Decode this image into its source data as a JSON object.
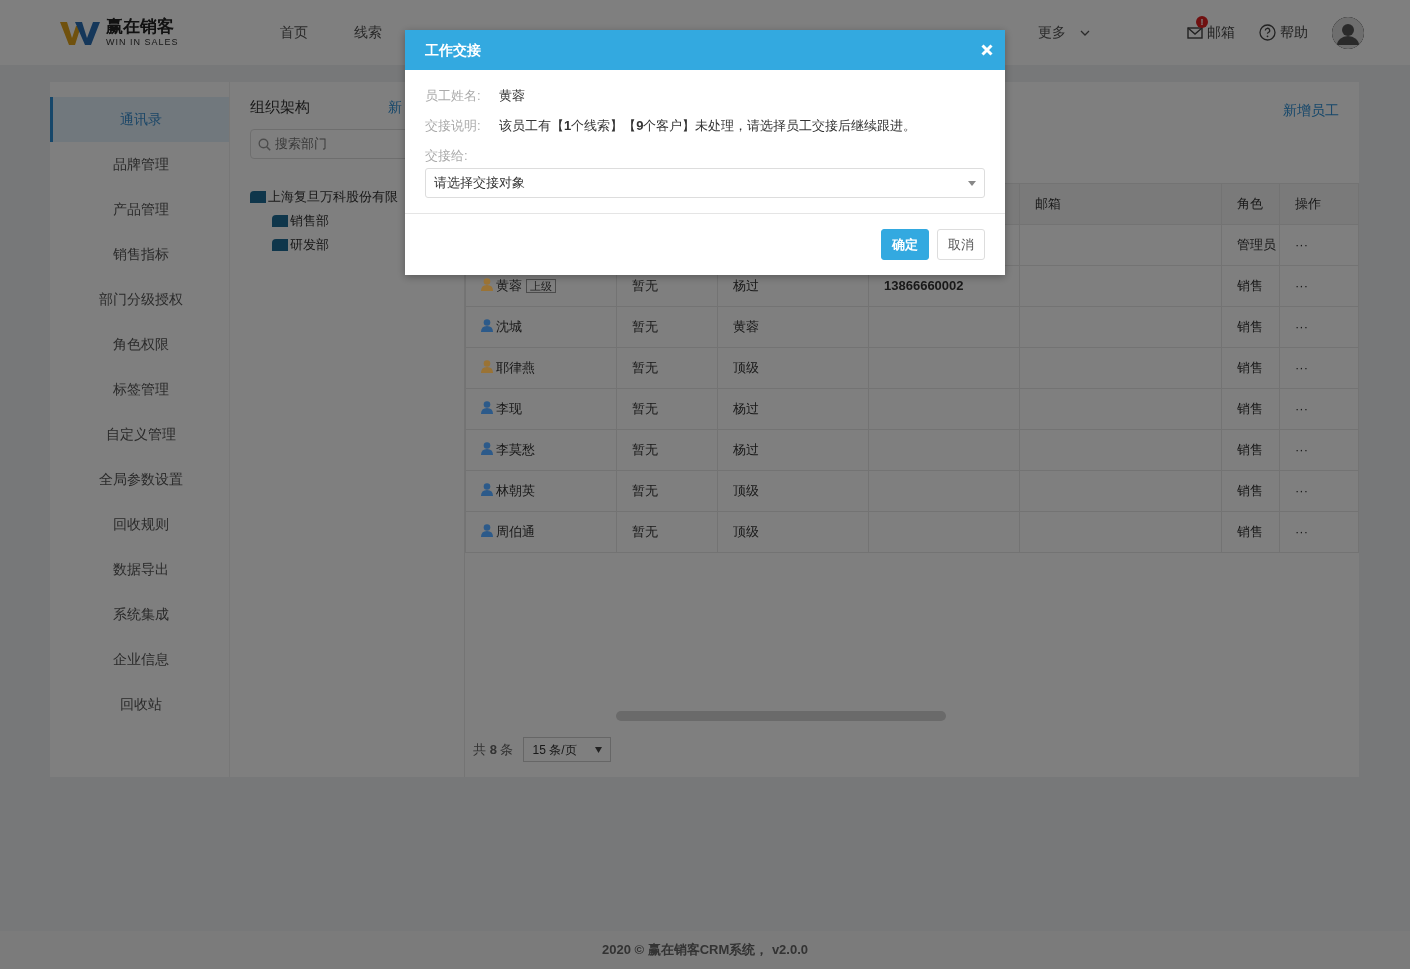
{
  "header": {
    "logo": {
      "name": "赢在销客",
      "tagline": "WIN IN SALES"
    },
    "nav": [
      "首页",
      "线索"
    ],
    "more": "更多",
    "mail": {
      "label": "邮箱",
      "alert": "!"
    },
    "help": {
      "label": "帮助"
    }
  },
  "sidebar": {
    "items": [
      {
        "label": "通讯录",
        "selected": true
      },
      {
        "label": "品牌管理",
        "selected": false
      },
      {
        "label": "产品管理",
        "selected": false
      },
      {
        "label": "销售指标",
        "selected": false
      },
      {
        "label": "部门分级授权",
        "selected": false
      },
      {
        "label": "角色权限",
        "selected": false
      },
      {
        "label": "标签管理",
        "selected": false
      },
      {
        "label": "自定义管理",
        "selected": false
      },
      {
        "label": "全局参数设置",
        "selected": false
      },
      {
        "label": "回收规则",
        "selected": false
      },
      {
        "label": "数据导出",
        "selected": false
      },
      {
        "label": "系统集成",
        "selected": false
      },
      {
        "label": "企业信息",
        "selected": false
      },
      {
        "label": "回收站",
        "selected": false
      }
    ]
  },
  "org": {
    "title": "组织架构",
    "add_link": "新",
    "search": {
      "placeholder": "搜索部门"
    },
    "tree": [
      {
        "label": "上海复旦万科股份有限",
        "children": [
          {
            "label": "销售部"
          },
          {
            "label": "研发部"
          }
        ]
      }
    ]
  },
  "staff": {
    "add_button": "新增员工",
    "columns": {
      "column_5": "邮箱",
      "column_6": "角色",
      "column_7": "操作"
    },
    "rows": [
      {
        "column_6": "管理员",
        "column_7": "···"
      },
      {
        "column_1": "黄蓉",
        "tag": "上级",
        "color": "#9a7335",
        "column_2": "暂无",
        "column_3": "杨过",
        "column_4": "13866660002",
        "column_6": "销售",
        "column_7": "···"
      },
      {
        "column_1": "沈城",
        "color": "#2c5a8a",
        "column_2": "暂无",
        "column_3": "黄蓉",
        "column_6": "销售",
        "column_7": "···"
      },
      {
        "column_1": "耶律燕",
        "color": "#9a7335",
        "column_2": "暂无",
        "column_3": "顶级",
        "column_6": "销售",
        "column_7": "···"
      },
      {
        "column_1": "李现",
        "color": "#2c5a8a",
        "column_2": "暂无",
        "column_3": "杨过",
        "column_6": "销售",
        "column_7": "···"
      },
      {
        "column_1": "李莫愁",
        "color": "#2c5a8a",
        "column_2": "暂无",
        "column_3": "杨过",
        "column_6": "销售",
        "column_7": "···"
      },
      {
        "column_1": "林朝英",
        "color": "#2c5a8a",
        "column_2": "暂无",
        "column_3": "顶级",
        "column_6": "销售",
        "column_7": "···"
      },
      {
        "column_1": "周伯通",
        "color": "#2c5a8a",
        "column_2": "暂无",
        "column_3": "顶级",
        "column_6": "销售",
        "column_7": "···"
      }
    ],
    "pager": {
      "total": "共 **8** 条",
      "page_size": "15 条/页"
    }
  },
  "footer": "2020 © 赢在销客CRM系统， v2.0.0",
  "dialog": {
    "title": "工作交接",
    "fields": [
      {
        "label": "员工姓名:",
        "value": "黄蓉"
      },
      {
        "label": "交接说明:",
        "value": "该员工有【**1**个线索】【**9**个客户】未处理，请选择员工交接后继续跟进。"
      }
    ],
    "assign": {
      "label": "交接给:",
      "placeholder": "请选择交接对象"
    },
    "buttons": [
      {
        "label": "确定",
        "kind": "primary"
      },
      {
        "label": "取消",
        "kind": "default"
      }
    ]
  }
}
